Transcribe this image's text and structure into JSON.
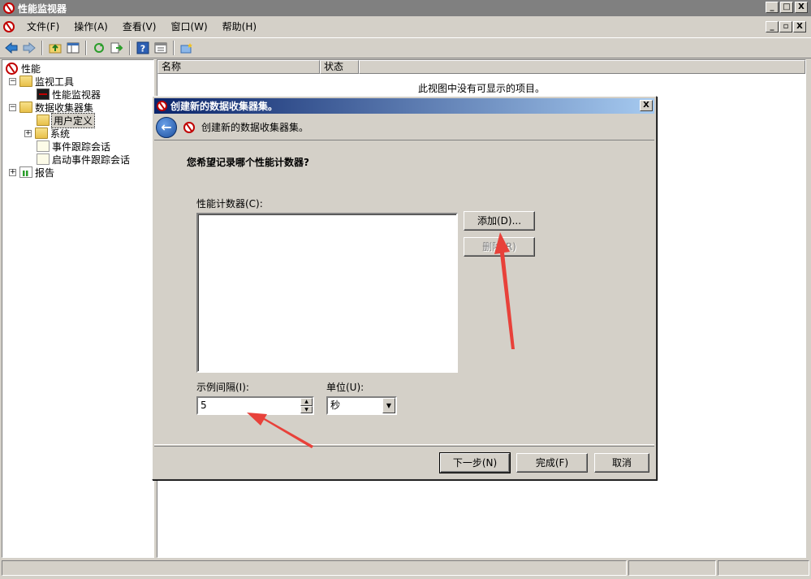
{
  "window": {
    "title": "性能监视器",
    "controls": [
      "_",
      "□",
      "X"
    ],
    "mdi_controls": [
      "_",
      "▫",
      "X"
    ]
  },
  "menu": [
    "文件(F)",
    "操作(A)",
    "查看(V)",
    "窗口(W)",
    "帮助(H)"
  ],
  "toolbar": [
    "back-icon",
    "forward-icon",
    "up-folder-icon",
    "show-hide-tree-icon",
    "refresh-icon",
    "export-icon",
    "help-icon",
    "properties-icon",
    "new-item-icon"
  ],
  "tree": {
    "root": "性能",
    "monitor_tools": "监视工具",
    "perf_monitor": "性能监视器",
    "data_collector_sets": "数据收集器集",
    "user_defined": "用户定义",
    "system": "系统",
    "event_trace_sessions": "事件跟踪会话",
    "startup_event_trace_sessions": "启动事件跟踪会话",
    "reports": "报告",
    "expander_expanded": "−",
    "expander_collapsed": "+"
  },
  "list": {
    "col_name": "名称",
    "col_status": "状态",
    "empty_message": "此视图中没有可显示的项目。"
  },
  "dialog": {
    "title": "创建新的数据收集器集。",
    "header": "创建新的数据收集器集。",
    "close": "X",
    "back": "←",
    "question": "您希望记录哪个性能计数器?",
    "counters_label": "性能计数器(C):",
    "add_button": "添加(D)...",
    "remove_button": "删除(R)",
    "interval_label": "示例间隔(I):",
    "interval_value": "5",
    "unit_label": "单位(U):",
    "unit_value": "秒",
    "next_button": "下一步(N)",
    "finish_button": "完成(F)",
    "cancel_button": "取消"
  },
  "colors": {
    "annotation_arrow": "#e8413a",
    "dialog_title_start": "#0a246a",
    "dialog_title_end": "#a6caf0"
  }
}
